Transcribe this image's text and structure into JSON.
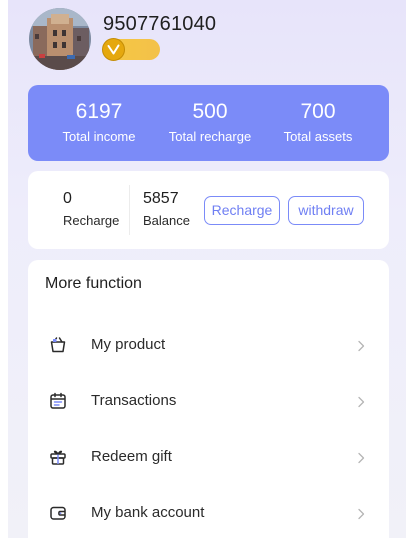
{
  "header": {
    "phone": "9507761040",
    "avatar_icon": "avatar-photo",
    "vip_icon": "vip-check-icon"
  },
  "stats": [
    {
      "value": "6197",
      "label": "Total income"
    },
    {
      "value": "500",
      "label": "Total recharge"
    },
    {
      "value": "700",
      "label": "Total assets"
    }
  ],
  "balance": {
    "recharge_value": "0",
    "recharge_label": "Recharge",
    "balance_value": "5857",
    "balance_label": "Balance",
    "recharge_button": "Recharge",
    "withdraw_button": "withdraw"
  },
  "functions": {
    "title": "More function",
    "items": [
      {
        "label": "My product",
        "icon": "basket-icon"
      },
      {
        "label": "Transactions",
        "icon": "calendar-icon"
      },
      {
        "label": "Redeem gift",
        "icon": "gift-icon"
      },
      {
        "label": "My bank account",
        "icon": "wallet-icon"
      }
    ]
  },
  "colors": {
    "accent": "#7b8bf8",
    "gold": "#f5c842",
    "background": "#e7e4fa"
  }
}
